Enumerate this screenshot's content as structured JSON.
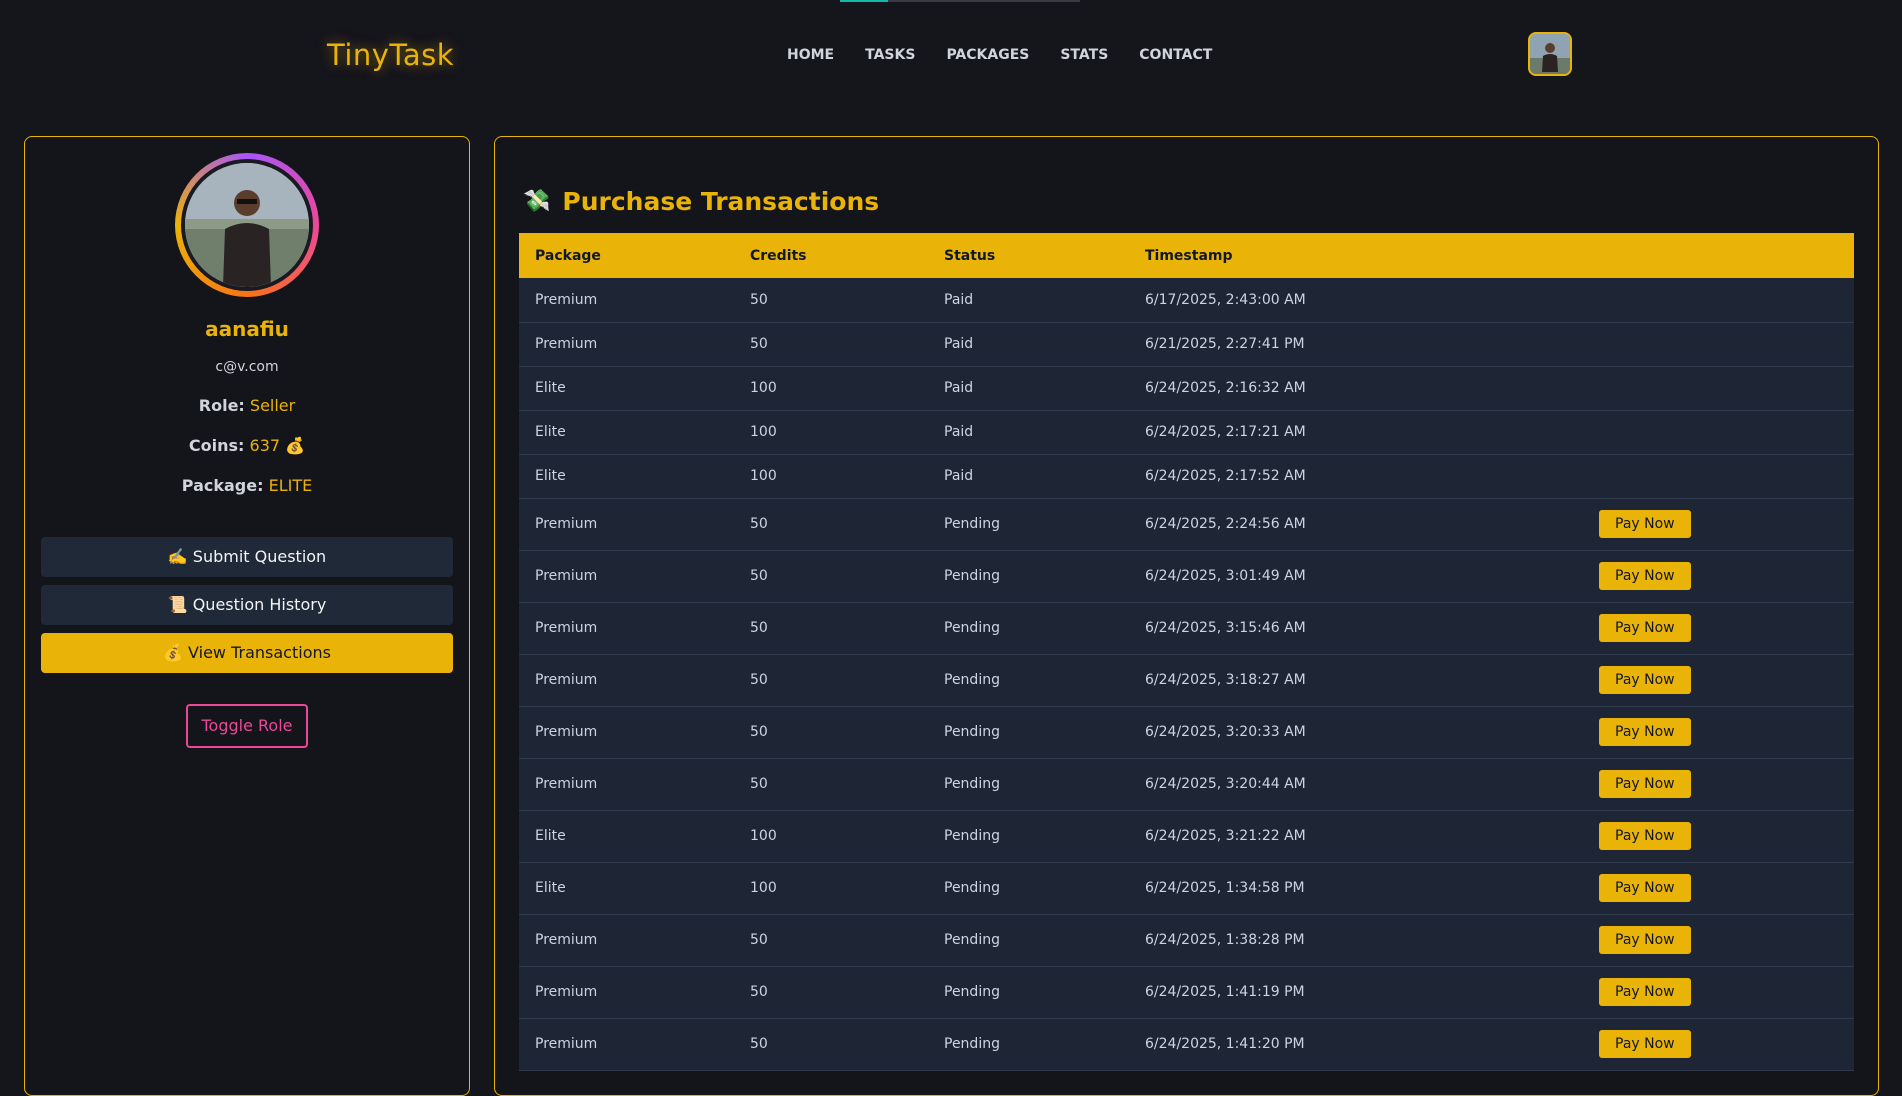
{
  "brand": "TinyTask",
  "nav": [
    "HOME",
    "TASKS",
    "PACKAGES",
    "STATS",
    "CONTACT"
  ],
  "profile": {
    "username": "aanafiu",
    "email": "c@v.com",
    "role_label": "Role:",
    "role": "Seller",
    "coins_label": "Coins:",
    "coins": "637",
    "coin_icon": "💰",
    "package_label": "Package:",
    "package": "ELITE"
  },
  "sidebar_buttons": {
    "submit": "✍️ Submit Question",
    "history": "📜 Question History",
    "transactions": "💰 View Transactions",
    "toggle": "Toggle Role"
  },
  "page": {
    "icon": "💸",
    "title": "Purchase Transactions"
  },
  "table": {
    "headers": [
      "Package",
      "Credits",
      "Status",
      "Timestamp",
      ""
    ],
    "pay_label": "Pay Now",
    "rows": [
      {
        "package": "Premium",
        "credits": "50",
        "status": "Paid",
        "timestamp": "6/17/2025, 2:43:00 AM"
      },
      {
        "package": "Premium",
        "credits": "50",
        "status": "Paid",
        "timestamp": "6/21/2025, 2:27:41 PM"
      },
      {
        "package": "Elite",
        "credits": "100",
        "status": "Paid",
        "timestamp": "6/24/2025, 2:16:32 AM"
      },
      {
        "package": "Elite",
        "credits": "100",
        "status": "Paid",
        "timestamp": "6/24/2025, 2:17:21 AM"
      },
      {
        "package": "Elite",
        "credits": "100",
        "status": "Paid",
        "timestamp": "6/24/2025, 2:17:52 AM"
      },
      {
        "package": "Premium",
        "credits": "50",
        "status": "Pending",
        "timestamp": "6/24/2025, 2:24:56 AM"
      },
      {
        "package": "Premium",
        "credits": "50",
        "status": "Pending",
        "timestamp": "6/24/2025, 3:01:49 AM"
      },
      {
        "package": "Premium",
        "credits": "50",
        "status": "Pending",
        "timestamp": "6/24/2025, 3:15:46 AM"
      },
      {
        "package": "Premium",
        "credits": "50",
        "status": "Pending",
        "timestamp": "6/24/2025, 3:18:27 AM"
      },
      {
        "package": "Premium",
        "credits": "50",
        "status": "Pending",
        "timestamp": "6/24/2025, 3:20:33 AM"
      },
      {
        "package": "Premium",
        "credits": "50",
        "status": "Pending",
        "timestamp": "6/24/2025, 3:20:44 AM"
      },
      {
        "package": "Elite",
        "credits": "100",
        "status": "Pending",
        "timestamp": "6/24/2025, 3:21:22 AM"
      },
      {
        "package": "Elite",
        "credits": "100",
        "status": "Pending",
        "timestamp": "6/24/2025, 1:34:58 PM"
      },
      {
        "package": "Premium",
        "credits": "50",
        "status": "Pending",
        "timestamp": "6/24/2025, 1:38:28 PM"
      },
      {
        "package": "Premium",
        "credits": "50",
        "status": "Pending",
        "timestamp": "6/24/2025, 1:41:19 PM"
      },
      {
        "package": "Premium",
        "credits": "50",
        "status": "Pending",
        "timestamp": "6/24/2025, 1:41:20 PM"
      }
    ]
  },
  "colors": {
    "accent": "#eab308",
    "background": "#15151c",
    "row": "#1e2636",
    "toggle": "#ec4899"
  }
}
